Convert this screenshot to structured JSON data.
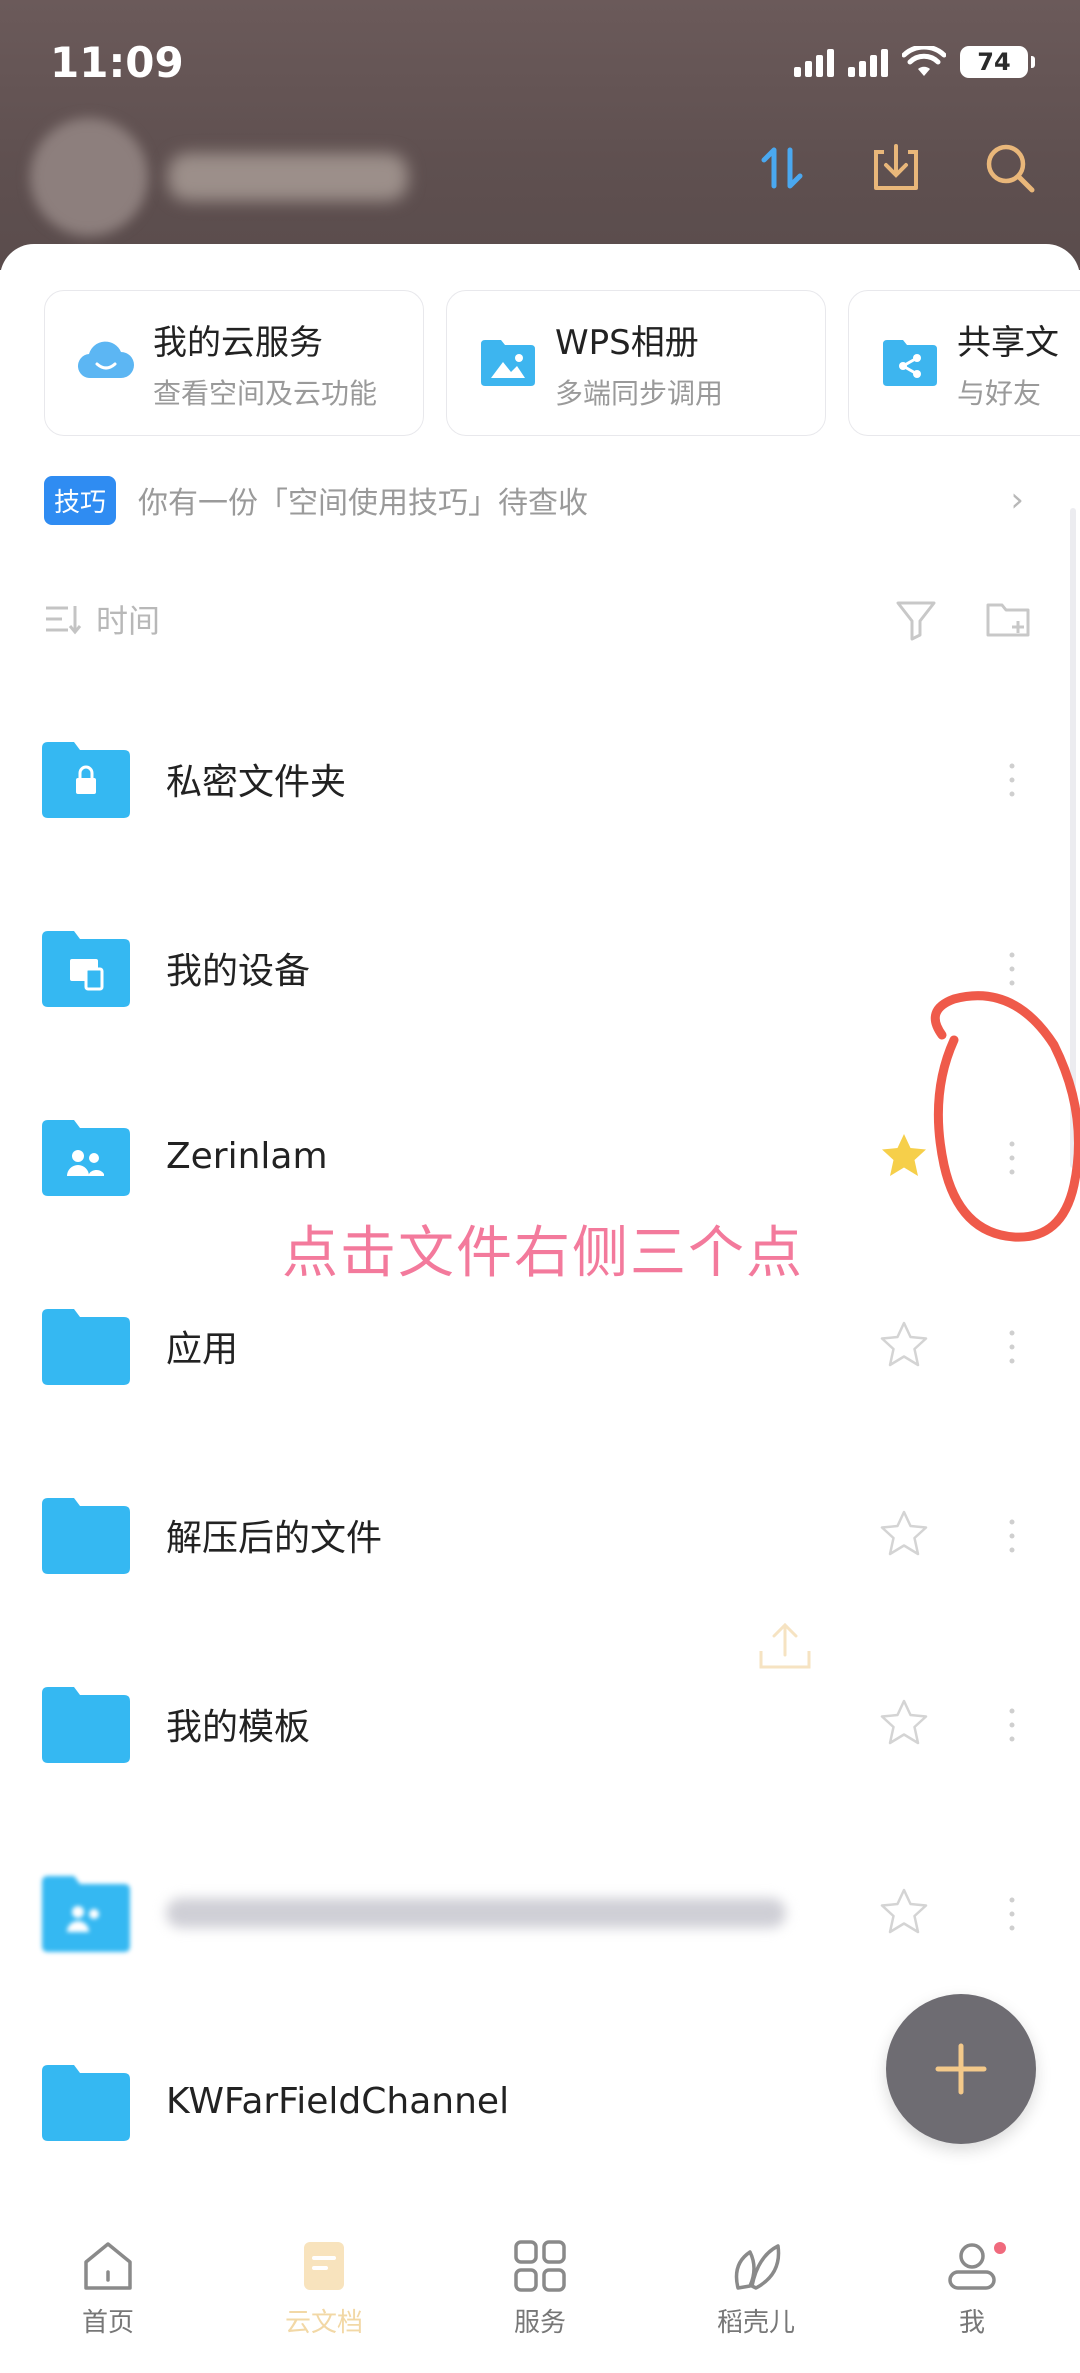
{
  "status": {
    "time": "11:09",
    "battery": "74"
  },
  "cards": [
    {
      "title": "我的云服务",
      "subtitle": "查看空间及云功能",
      "icon": "cloud-icon"
    },
    {
      "title": "WPS相册",
      "subtitle": "多端同步调用",
      "icon": "photo-album-icon"
    },
    {
      "title": "共享文",
      "subtitle": "与好友",
      "icon": "share-folder-icon"
    }
  ],
  "tip": {
    "badge": "技巧",
    "text": "你有一份「空间使用技巧」待查收"
  },
  "sort": {
    "label": "时间"
  },
  "files": [
    {
      "name": "私密文件夹"
    },
    {
      "name": "我的设备"
    },
    {
      "name": "Zerinlam",
      "starred": true
    },
    {
      "name": "应用"
    },
    {
      "name": "解压后的文件"
    },
    {
      "name": "我的模板"
    },
    {
      "name": ""
    },
    {
      "name": "KWFarFieldChannel"
    }
  ],
  "annotation": "点击文件右侧三个点",
  "nav": [
    {
      "label": "首页"
    },
    {
      "label": "云文档"
    },
    {
      "label": "服务"
    },
    {
      "label": "稻壳儿"
    },
    {
      "label": "我"
    }
  ],
  "colors": {
    "accent": "#2f8cf2",
    "folder": "#35b8f2",
    "annotation": "#f37a9c",
    "fab": "#6e6c72",
    "header": "#5f5050"
  }
}
